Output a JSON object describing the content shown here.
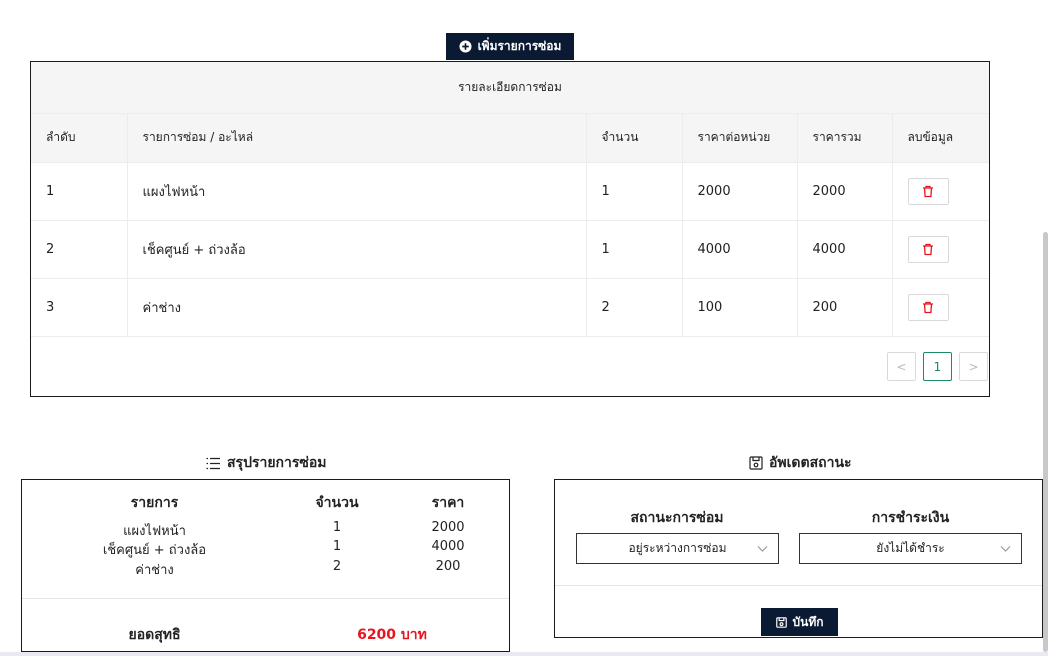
{
  "repair": {
    "add_button_label": "เพิ่มรายการซ่อม",
    "table_title": "รายละเอียดการซ่อม",
    "columns": [
      "ลำดับ",
      "รายการซ่อม / อะไหล่",
      "จำนวน",
      "ราคาต่อหน่วย",
      "ราคารวม",
      "ลบข้อมูล"
    ],
    "rows": [
      {
        "no": "1",
        "item": "แผงไฟหน้า",
        "qty": "1",
        "unit_price": "2000",
        "total": "2000"
      },
      {
        "no": "2",
        "item": "เช็คศูนย์ + ถ่วงล้อ",
        "qty": "1",
        "unit_price": "4000",
        "total": "4000"
      },
      {
        "no": "3",
        "item": "ค่าช่าง",
        "qty": "2",
        "unit_price": "100",
        "total": "200"
      }
    ],
    "pagination": {
      "prev": "<",
      "current": "1",
      "next": ">"
    }
  },
  "summary": {
    "heading": "สรุปรายการซ่อม",
    "headers": [
      "รายการ",
      "จำนวน",
      "ราคา"
    ],
    "items": [
      {
        "name": "แผงไฟหน้า",
        "qty": "1",
        "price": "2000"
      },
      {
        "name": "เช็คศูนย์ + ถ่วงล้อ",
        "qty": "1",
        "price": "4000"
      },
      {
        "name": "ค่าช่าง",
        "qty": "2",
        "price": "200"
      }
    ],
    "total_label": "ยอดสุทธิ",
    "total_value": "6200 บาท",
    "total_color": "#e8141f"
  },
  "status": {
    "heading": "อัพเดตสถานะ",
    "repair_status_label": "สถานะการซ่อม",
    "repair_status_value": "อยู่ระหว่างการซ่อม",
    "payment_label": "การชำระเงิน",
    "payment_value": "ยังไม่ได้ชำระ",
    "save_label": "บันทึก"
  },
  "colors": {
    "dark_button": "#0b1a33",
    "accent": "#1b8a6b",
    "delete": "#e8141f"
  }
}
